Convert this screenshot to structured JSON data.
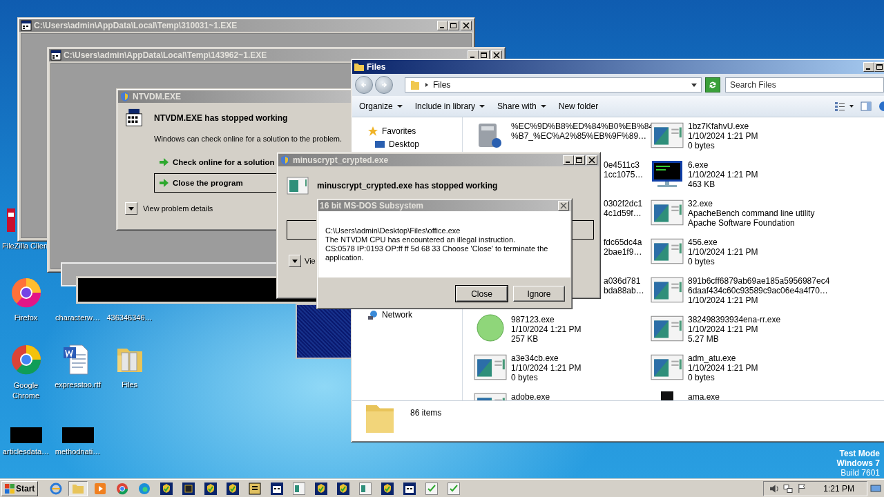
{
  "desktop": {
    "partial_icons": [
      {
        "label": "FileZilla Clien",
        "kind": "program"
      }
    ],
    "icons": [
      {
        "label": "Firefox",
        "kind": "globe"
      },
      {
        "label": "characterw…",
        "kind": "hidden"
      },
      {
        "label": "436346346…",
        "kind": "hidden"
      },
      {
        "label": "Google Chrome",
        "kind": "globe"
      },
      {
        "label": "expresstoo.rtf",
        "kind": "document"
      },
      {
        "label": "Files",
        "kind": "folder"
      },
      {
        "label": "articlesdata…",
        "kind": "black"
      },
      {
        "label": "methodnati…",
        "kind": "black"
      }
    ],
    "notice": [
      "Test Mode",
      "Windows 7",
      "Build 7601"
    ]
  },
  "consoles": [
    {
      "title": "C:\\Users\\admin\\AppData\\Local\\Temp\\310031~1.EXE"
    },
    {
      "title": "C:\\Users\\admin\\AppData\\Local\\Temp\\143962~1.EXE"
    }
  ],
  "ntvdm_dialog": {
    "title": "NTVDM.EXE",
    "heading": "NTVDM.EXE has stopped working",
    "message": "Windows can check online for a solution to the problem.",
    "options": [
      {
        "label": "Check online for a solution",
        "selected": false
      },
      {
        "label": "Close the program",
        "selected": true
      }
    ],
    "details_label": "View problem details"
  },
  "explorer": {
    "title": "Files",
    "address": "Files",
    "search_placeholder": "Search Files",
    "toolbar": [
      {
        "label": "Organize",
        "dropdown": true
      },
      {
        "label": "Include in library",
        "dropdown": true
      },
      {
        "label": "Share with",
        "dropdown": true
      },
      {
        "label": "New folder",
        "dropdown": false
      }
    ],
    "nav": [
      {
        "label": "Favorites",
        "kind": "favorites"
      },
      {
        "label": "Desktop",
        "kind": "desktop"
      },
      {
        "label": "Network",
        "kind": "network"
      }
    ],
    "column_1": [
      {
        "kind": "drive",
        "lines": [
          "%EC%9D%B8%ED%84%B0%EB%84",
          "%B7_%EC%A2%85%EB%9F%89…"
        ]
      },
      {
        "kind": "hidden",
        "lines": [
          "0e4511c3",
          "1cc1075…"
        ]
      },
      {
        "kind": "hidden",
        "lines": [
          "0302f2dc1",
          "4c1d59f…"
        ]
      },
      {
        "kind": "hidden",
        "lines": [
          "fdc65dc4a",
          "2bae1f9…"
        ]
      },
      {
        "kind": "hidden",
        "lines": [
          "a036d781",
          "bda88ab…"
        ]
      },
      {
        "kind": "orb",
        "lines": [
          "987123.exe",
          "1/10/2024 1:21 PM",
          "257 KB"
        ]
      },
      {
        "kind": "program",
        "lines": [
          "a3e34cb.exe",
          "1/10/2024 1:21 PM",
          "0 bytes"
        ]
      },
      {
        "kind": "program",
        "lines": [
          "adobe.exe"
        ]
      }
    ],
    "column_2": [
      {
        "kind": "program",
        "lines": [
          "1bz7KfahvU.exe",
          "1/10/2024 1:21 PM",
          "0 bytes"
        ]
      },
      {
        "kind": "console",
        "lines": [
          "6.exe",
          "1/10/2024 1:21 PM",
          "463 KB"
        ]
      },
      {
        "kind": "program",
        "lines": [
          "32.exe",
          "ApacheBench command line utility",
          "Apache Software Foundation"
        ]
      },
      {
        "kind": "program",
        "lines": [
          "456.exe",
          "1/10/2024 1:21 PM",
          "0 bytes"
        ]
      },
      {
        "kind": "program",
        "lines": [
          "891b6cff6879ab69ae185a5956987ec4",
          "6daaf434c60c93589c9ac06e4a4f70…",
          "1/10/2024 1:21 PM"
        ]
      },
      {
        "kind": "program",
        "lines": [
          "382498393934ena-rr.exe",
          "1/10/2024 1:21 PM",
          "5.27 MB"
        ]
      },
      {
        "kind": "program",
        "lines": [
          "adm_atu.exe",
          "1/10/2024 1:21 PM",
          "0 bytes"
        ]
      },
      {
        "kind": "black",
        "lines": [
          "ama.exe"
        ]
      }
    ],
    "status": "86 items"
  },
  "crash_dialog": {
    "title": "minuscrypt_crypted.exe",
    "heading": "minuscrypt_crypted.exe has stopped working",
    "details_label": "Vie"
  },
  "dos_dialog": {
    "title": "16 bit MS-DOS Subsystem",
    "lines": [
      "C:\\Users\\admin\\Desktop\\Files\\office.exe",
      "The NTVDM CPU has encountered an illegal instruction.",
      "CS:0578 IP:0193 OP:ff ff 5d 68 33 Choose 'Close' to terminate the application."
    ],
    "buttons": [
      {
        "label": "Close",
        "selected": true
      },
      {
        "label": "Ignore",
        "selected": false
      }
    ]
  },
  "taskbar": {
    "start": "Start",
    "clock": "1:21 PM",
    "tasks": [
      {
        "kind": "ie",
        "selected": false
      },
      {
        "kind": "folder",
        "selected": true
      },
      {
        "kind": "media",
        "selected": false
      },
      {
        "kind": "globe",
        "selected": false
      },
      {
        "kind": "edge",
        "selected": false
      },
      {
        "kind": "crash",
        "selected": false
      },
      {
        "kind": "chip",
        "selected": false
      },
      {
        "kind": "crash",
        "selected": false
      },
      {
        "kind": "crash",
        "selected": false
      },
      {
        "kind": "tool",
        "selected": false
      },
      {
        "kind": "dos",
        "selected": false
      },
      {
        "kind": "window",
        "selected": false
      },
      {
        "kind": "crash",
        "selected": false
      },
      {
        "kind": "crash",
        "selected": false
      },
      {
        "kind": "window",
        "selected": false
      },
      {
        "kind": "crash",
        "selected": false
      },
      {
        "kind": "dos",
        "selected": false
      },
      {
        "kind": "check",
        "selected": false
      },
      {
        "kind": "check",
        "selected": false
      }
    ]
  }
}
